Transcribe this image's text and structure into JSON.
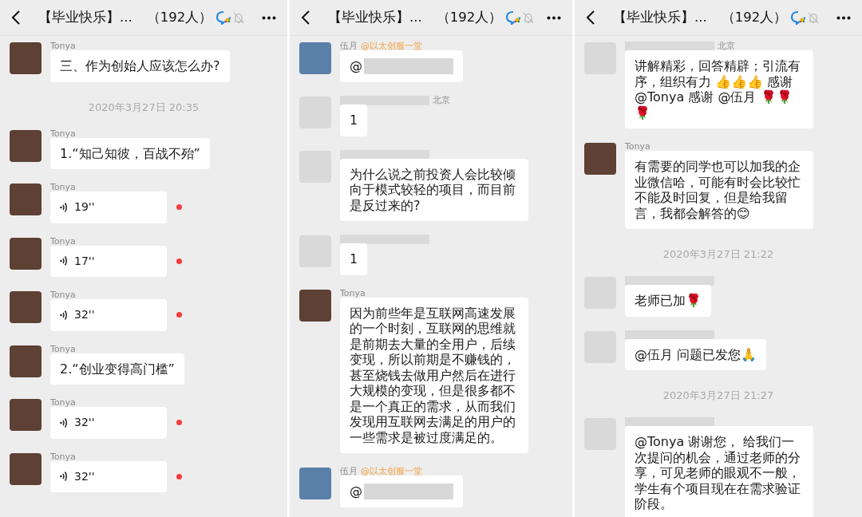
{
  "panels": [
    {
      "header": {
        "title": "【毕业快乐】...",
        "member_count": "（192人）"
      },
      "messages": [
        {
          "kind": "text",
          "sender": "Tonya",
          "avatar": {
            "color": "#5e4034"
          },
          "body": "三、作为创始人应该怎么办?"
        },
        {
          "kind": "time",
          "text": "2020年3月27日 20:35"
        },
        {
          "kind": "text",
          "sender": "Tonya",
          "avatar": {
            "color": "#5e4034"
          },
          "body": "1.“知己知彼，百战不殆”"
        },
        {
          "kind": "voice",
          "sender": "Tonya",
          "avatar": {
            "color": "#5e4034"
          },
          "duration": "19''",
          "unread": true
        },
        {
          "kind": "voice",
          "sender": "Tonya",
          "avatar": {
            "color": "#5e4034"
          },
          "duration": "17''",
          "unread": true
        },
        {
          "kind": "voice",
          "sender": "Tonya",
          "avatar": {
            "color": "#5e4034"
          },
          "duration": "32''",
          "unread": true
        },
        {
          "kind": "text",
          "sender": "Tonya",
          "avatar": {
            "color": "#5e4034"
          },
          "body": "2.“创业变得高门槛”"
        },
        {
          "kind": "voice",
          "sender": "Tonya",
          "avatar": {
            "color": "#5e4034"
          },
          "duration": "32''",
          "unread": true
        },
        {
          "kind": "voice",
          "sender": "Tonya",
          "avatar": {
            "color": "#5e4034"
          },
          "duration": "32''",
          "unread": true
        }
      ]
    },
    {
      "header": {
        "title": "【毕业快乐】...",
        "member_count": "（192人）"
      },
      "messages": [
        {
          "kind": "text",
          "sender": "伍月",
          "sender_tag": "@以太创服一堂",
          "avatar": {
            "color": "#5a7fa8"
          },
          "body": "@",
          "mention_hidden": true
        },
        {
          "kind": "text",
          "sender_hidden": true,
          "location": "北京",
          "avatar": {
            "color": "#d9d9d9"
          },
          "body": "1"
        },
        {
          "kind": "text",
          "sender_hidden": true,
          "avatar": {
            "color": "#d9d9d9"
          },
          "body": "为什么说之前投资人会比较倾向于模式较轻的项目，而目前是反过来的?"
        },
        {
          "kind": "text",
          "sender_hidden": true,
          "avatar": {
            "color": "#d9d9d9"
          },
          "body": "1"
        },
        {
          "kind": "text",
          "sender": "Tonya",
          "avatar": {
            "color": "#5e4034"
          },
          "body": "因为前些年是互联网高速发展的一个时刻，互联网的思维就是前期去大量的全用户，后续变现，所以前期是不赚钱的，甚至烧钱去做用户然后在进行大规模的变现，但是很多都不是一个真正的需求，从而我们发现用互联网去满足的用户的一些需求是被过度满足的。"
        },
        {
          "kind": "text",
          "sender": "伍月",
          "sender_tag": "@以太创服一堂",
          "avatar": {
            "color": "#5a7fa8"
          },
          "body": "@",
          "mention_hidden": true
        }
      ]
    },
    {
      "header": {
        "title": "【毕业快乐】...",
        "member_count": "（192人）"
      },
      "messages": [
        {
          "kind": "text",
          "sender_hidden": true,
          "location": "北京",
          "avatar": {
            "color": "#d9d9d9"
          },
          "body": "讲解精彩，回答精辟；引流有序，组织有力 👍👍👍 感谢 @Tonya 感谢 @伍月 🌹🌹🌹"
        },
        {
          "kind": "text",
          "sender": "Tonya",
          "avatar": {
            "color": "#5e4034"
          },
          "body": "有需要的同学也可以加我的企业微信哈，可能有时会比较忙不能及时回复，但是给我留言，我都会解答的😊"
        },
        {
          "kind": "time",
          "text": "2020年3月27日 21:22"
        },
        {
          "kind": "text",
          "sender_hidden": true,
          "avatar": {
            "color": "#d9d9d9"
          },
          "body": "老师已加🌹"
        },
        {
          "kind": "text",
          "sender_hidden": true,
          "avatar": {
            "color": "#d9d9d9"
          },
          "body": "@伍月 问题已发您🙏"
        },
        {
          "kind": "time",
          "text": "2020年3月27日 21:27"
        },
        {
          "kind": "text",
          "sender_hidden": true,
          "avatar": {
            "color": "#d9d9d9"
          },
          "body": "@Tonya  谢谢您， 给我们一次提问的机会，通过老师的分享，可见老师的眼观不一般，学生有个项目现在在需求验证阶段。"
        }
      ]
    }
  ]
}
